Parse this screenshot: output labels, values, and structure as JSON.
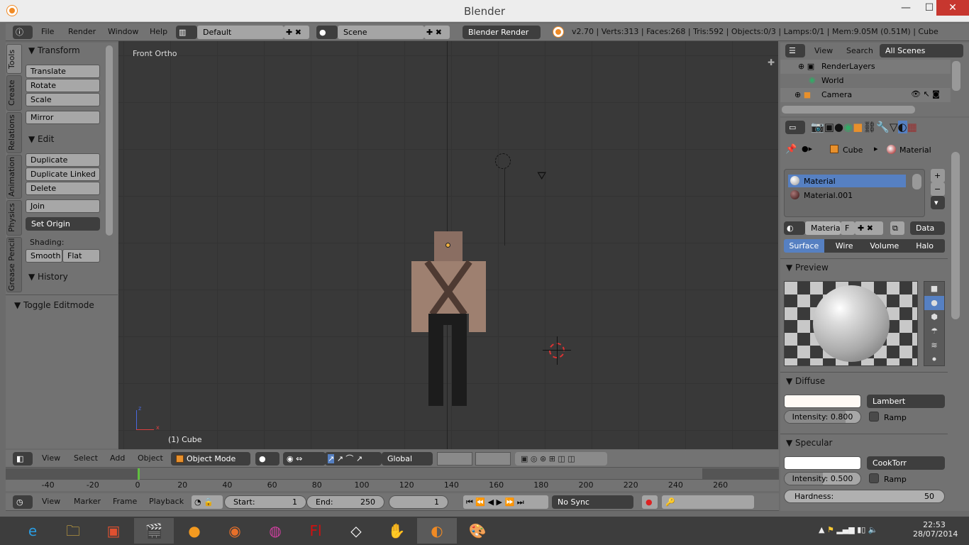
{
  "window": {
    "title": "Blender",
    "minimize": "—",
    "maximize": "☐",
    "close": "✕"
  },
  "info_header": {
    "menus": [
      "File",
      "Render",
      "Window",
      "Help"
    ],
    "layout": "Default",
    "scene": "Scene",
    "engine": "Blender Render",
    "stats": "v2.70 | Verts:313 | Faces:268 | Tris:592 | Objects:0/3 | Lamps:0/1 | Mem:9.05M (0.51M) | Cube"
  },
  "tool_shelf": {
    "tabs": [
      "Tools",
      "Create",
      "Relations",
      "Animation",
      "Physics",
      "Grease Pencil"
    ],
    "transform": {
      "title": "Transform",
      "buttons": [
        "Translate",
        "Rotate",
        "Scale",
        "Mirror"
      ]
    },
    "edit": {
      "title": "Edit",
      "buttons": [
        "Duplicate",
        "Duplicate Linked",
        "Delete",
        "Join"
      ],
      "set_origin": "Set Origin",
      "shading_label": "Shading:",
      "smooth": "Smooth",
      "flat": "Flat"
    },
    "history": {
      "title": "History"
    },
    "operator": {
      "title": "Toggle Editmode"
    }
  },
  "viewport": {
    "view_name": "Front Ortho",
    "object_label": "(1) Cube",
    "axis_z": "z",
    "axis_x": "x"
  },
  "view3d_header": {
    "menus": [
      "View",
      "Select",
      "Add",
      "Object"
    ],
    "mode": "Object Mode",
    "orientation": "Global"
  },
  "timeline": {
    "ticks": [
      "-40",
      "-20",
      "0",
      "20",
      "40",
      "60",
      "80",
      "100",
      "120",
      "140",
      "160",
      "180",
      "200",
      "220",
      "240",
      "260"
    ],
    "current_frame_marker": 1,
    "menus": [
      "View",
      "Marker",
      "Frame",
      "Playback"
    ],
    "start_label": "Start:",
    "start": "1",
    "end_label": "End:",
    "end": "250",
    "current": "1",
    "sync": "No Sync"
  },
  "outliner": {
    "menus": [
      "View",
      "Search"
    ],
    "filter": "All Scenes",
    "items": [
      "RenderLayers",
      "World",
      "Camera"
    ]
  },
  "properties": {
    "breadcrumb": [
      "Cube",
      "Material"
    ],
    "materials": [
      "Material",
      "Material.001"
    ],
    "material_name": "Materia",
    "fake_user": "F",
    "data_link": "Data",
    "type_tabs": [
      "Surface",
      "Wire",
      "Volume",
      "Halo"
    ],
    "active_type": "Surface",
    "preview_title": "Preview",
    "diffuse": {
      "title": "Diffuse",
      "shader": "Lambert",
      "intensity_label": "Intensity:",
      "intensity": "0.800",
      "intensity_value": 0.8,
      "ramp": "Ramp",
      "color": "#fffaf5"
    },
    "specular": {
      "title": "Specular",
      "shader": "CookTorr",
      "intensity_label": "Intensity:",
      "intensity": "0.500",
      "intensity_value": 0.5,
      "ramp": "Ramp",
      "hardness_label": "Hardness:",
      "hardness": "50",
      "color": "#ffffff"
    }
  },
  "taskbar": {
    "time": "22:53",
    "date": "28/07/2014",
    "apps": [
      "internet-explorer",
      "file-explorer",
      "photo-app",
      "video-app",
      "blender-orange",
      "firefox",
      "media-app",
      "flash",
      "unity",
      "app-hand",
      "blender",
      "paint"
    ],
    "flash_label": "Fl"
  },
  "colors": {
    "accent": "#5680c2",
    "viewport_bg": "#393939",
    "ui_gray": "#737373",
    "close_red": "#c7372f"
  }
}
